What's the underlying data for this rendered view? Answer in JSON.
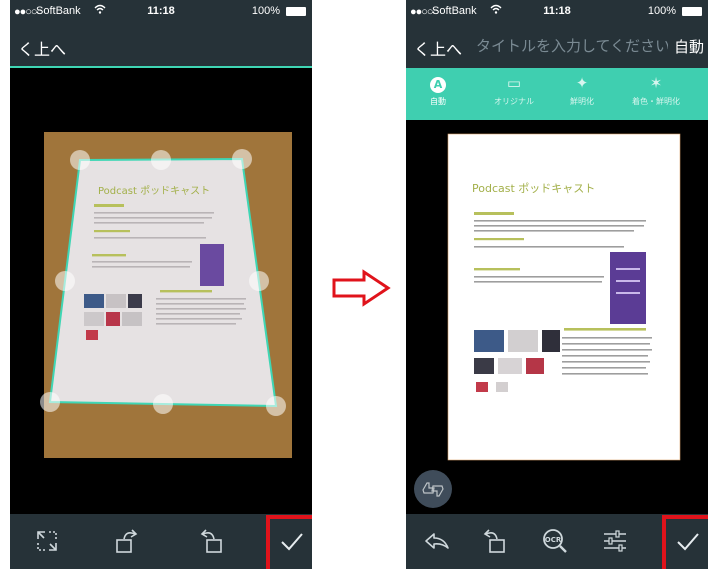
{
  "status": {
    "signal": "●●○○○",
    "carrier": "SoftBank",
    "time": "11:18",
    "battery": "100%"
  },
  "left": {
    "back_label": "く上へ",
    "document": {
      "title": "Podcast ポッドキャスト"
    },
    "toolbar": [
      "crop-expand-icon",
      "rotate-left-icon",
      "rotate-right-icon",
      "checkmark-icon"
    ]
  },
  "right": {
    "back_label": "く上へ",
    "title_placeholder": "タイトルを入力してください",
    "mode_label": "自動",
    "filters": [
      {
        "icon": "A",
        "label": "自動"
      },
      {
        "icon": "▭",
        "label": "オリジナル"
      },
      {
        "icon": "✦",
        "label": "鮮明化"
      },
      {
        "icon": "✶",
        "label": "着色・鮮明化"
      }
    ],
    "document": {
      "title": "Podcast ポッドキャスト"
    },
    "toolbar": [
      "undo-icon",
      "rotate-right-icon",
      "ocr-icon",
      "adjust-icon",
      "checkmark-icon"
    ]
  },
  "colors": {
    "nav_bg": "#263238",
    "accent_teal": "#3fcfb0",
    "highlight_red": "#e0131b"
  }
}
